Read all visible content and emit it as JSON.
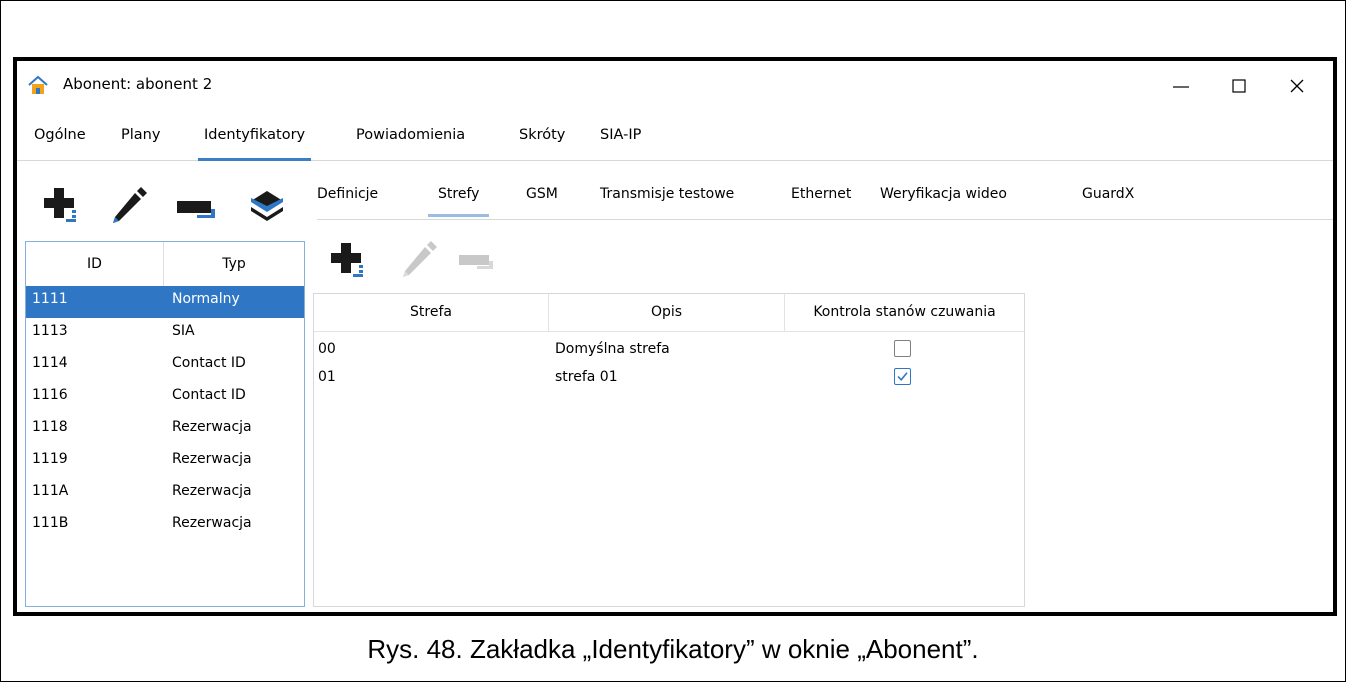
{
  "window": {
    "title": "Abonent: abonent 2",
    "controls": [
      "minimize-icon",
      "maximize-icon",
      "close-icon"
    ]
  },
  "main_tabs": [
    {
      "label": "Ogólne"
    },
    {
      "label": "Plany"
    },
    {
      "label": "Identyfikatory",
      "active": true
    },
    {
      "label": "Powiadomienia"
    },
    {
      "label": "Skróty"
    },
    {
      "label": "SIA-IP"
    }
  ],
  "left_toolbar": [
    "add-icon",
    "edit-icon",
    "remove-icon",
    "layers-icon"
  ],
  "sub_tabs": [
    {
      "label": "Definicje"
    },
    {
      "label": "Strefy",
      "active": true
    },
    {
      "label": "GSM"
    },
    {
      "label": "Transmisje testowe"
    },
    {
      "label": "Ethernet"
    },
    {
      "label": "Weryfikacja wideo"
    },
    {
      "label": "GuardX"
    }
  ],
  "identifiers": {
    "headers": {
      "id": "ID",
      "type": "Typ"
    },
    "rows": [
      {
        "id": "1111",
        "type": "Normalny",
        "selected": true
      },
      {
        "id": "1113",
        "type": "SIA"
      },
      {
        "id": "1114",
        "type": "Contact ID"
      },
      {
        "id": "1116",
        "type": "Contact ID"
      },
      {
        "id": "1118",
        "type": "Rezerwacja"
      },
      {
        "id": "1119",
        "type": "Rezerwacja"
      },
      {
        "id": "111A",
        "type": "Rezerwacja"
      },
      {
        "id": "111B",
        "type": "Rezerwacja"
      }
    ]
  },
  "zones_toolbar": [
    "add-icon",
    "edit-icon-disabled",
    "remove-icon-disabled"
  ],
  "zones": {
    "headers": {
      "zone": "Strefa",
      "description": "Opis",
      "arming_control": "Kontrola stanów czuwania"
    },
    "rows": [
      {
        "zone": "00",
        "description": "Domyślna strefa",
        "checked": false
      },
      {
        "zone": "01",
        "description": "strefa 01",
        "checked": true
      }
    ]
  },
  "caption": "Rys. 48. Zakładka „Identyfikatory” w oknie „Abonent”.",
  "colors": {
    "accent": "#3a7fc4",
    "selection": "#2f77c5",
    "toolbar_icon": "#1a1a1a",
    "disabled_icon": "#c8c8c8"
  }
}
